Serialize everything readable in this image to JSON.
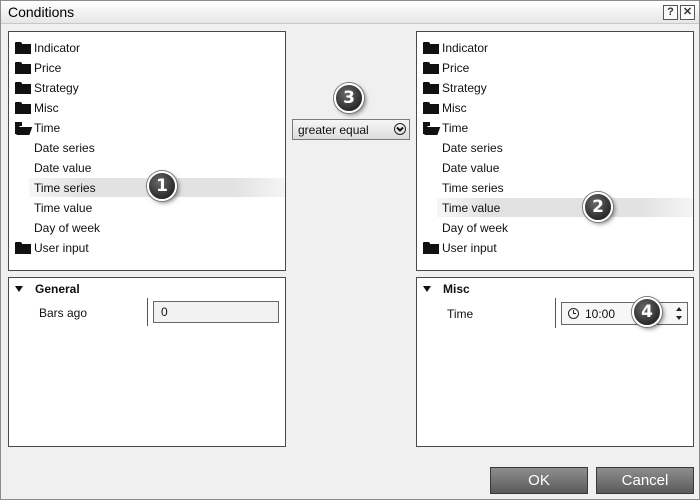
{
  "window": {
    "title": "Conditions",
    "help_label": "?",
    "close_label": "✕"
  },
  "left_tree": {
    "items": [
      {
        "label": "Indicator",
        "type": "folder"
      },
      {
        "label": "Price",
        "type": "folder"
      },
      {
        "label": "Strategy",
        "type": "folder"
      },
      {
        "label": "Misc",
        "type": "folder"
      },
      {
        "label": "Time",
        "type": "folder-open"
      },
      {
        "label": "Date series",
        "type": "child"
      },
      {
        "label": "Date value",
        "type": "child"
      },
      {
        "label": "Time series",
        "type": "child",
        "selected": true
      },
      {
        "label": "Time value",
        "type": "child"
      },
      {
        "label": "Day of week",
        "type": "child"
      },
      {
        "label": "User input",
        "type": "folder"
      }
    ]
  },
  "right_tree": {
    "items": [
      {
        "label": "Indicator",
        "type": "folder"
      },
      {
        "label": "Price",
        "type": "folder"
      },
      {
        "label": "Strategy",
        "type": "folder"
      },
      {
        "label": "Misc",
        "type": "folder"
      },
      {
        "label": "Time",
        "type": "folder-open"
      },
      {
        "label": "Date series",
        "type": "child"
      },
      {
        "label": "Date value",
        "type": "child"
      },
      {
        "label": "Time series",
        "type": "child"
      },
      {
        "label": "Time value",
        "type": "child",
        "selected": true
      },
      {
        "label": "Day of week",
        "type": "child"
      },
      {
        "label": "User input",
        "type": "folder"
      }
    ]
  },
  "operator": {
    "selected": "greater equal"
  },
  "left_props": {
    "header": "General",
    "row_label": "Bars ago",
    "row_value": "0"
  },
  "right_props": {
    "header": "Misc",
    "row_label": "Time",
    "row_value": "10:00"
  },
  "badges": {
    "one": "1",
    "two": "2",
    "three": "3",
    "four": "4"
  },
  "buttons": {
    "ok": "OK",
    "cancel": "Cancel"
  },
  "colors": {
    "button_bg": "#6e6e6e",
    "highlight": "#e2e2e2",
    "badge": "#3a3a3a"
  }
}
